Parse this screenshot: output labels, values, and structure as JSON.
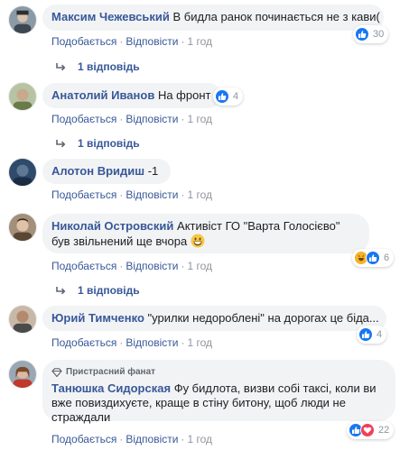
{
  "colors": {
    "link": "#385898",
    "bubble": "#f2f3f5",
    "meta": "#90949c",
    "like": "#1877f2",
    "love": "#f33e58",
    "haha": "#f7b125"
  },
  "actions": {
    "like": "Подобається",
    "reply": "Відповісти",
    "sep": "·"
  },
  "comments": [
    {
      "author": "Максим Чежевський",
      "text": "В бидла ранок починається не з кави(",
      "reactions": [
        "like-icon"
      ],
      "count": "30",
      "time": "1 год",
      "replies": "1 відповідь"
    },
    {
      "author": "Анатолий Иванов",
      "text": "На фронт",
      "reactions": [
        "like-icon"
      ],
      "count": "4",
      "time": "1 год",
      "replies": "1 відповідь"
    },
    {
      "author": "Алотон Вридиш",
      "text": "-1",
      "time": "1 год"
    },
    {
      "author": "Николай Островский",
      "text": "Активіст ГО \"Варта Голосієво\" був звільнений ще вчора",
      "emoji": "grinning-emoji-icon",
      "reactions": [
        "haha-icon",
        "like-icon"
      ],
      "count": "6",
      "time": "1 год",
      "replies": "1 відповідь"
    },
    {
      "author": "Юрий Тимченко",
      "text": "\"урилки недороблені\" на дорогах це біда...",
      "reactions": [
        "like-icon"
      ],
      "count": "4",
      "time": "1 год"
    },
    {
      "author": "Танюшка Сидорская",
      "badge": "Пристрасний фанат",
      "text": "Фу бидлота, визви собі таксі, коли ви вже повиздихуєте, краще в стіну битону, щоб люди не страждали",
      "reactions": [
        "like-icon",
        "love-icon"
      ],
      "count": "22",
      "time": "1 год"
    }
  ]
}
